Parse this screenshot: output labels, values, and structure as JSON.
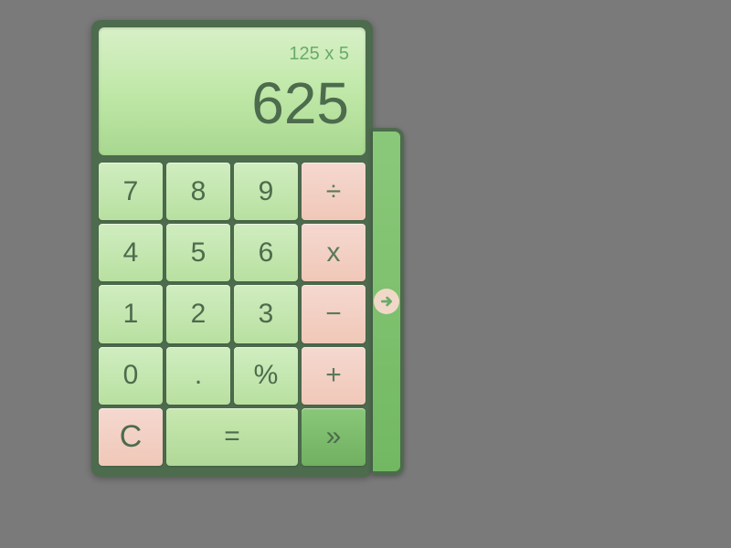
{
  "display": {
    "expression": "125 x 5",
    "result": "625"
  },
  "keys": {
    "n7": "7",
    "n8": "8",
    "n9": "9",
    "divide": "÷",
    "n4": "4",
    "n5": "5",
    "n6": "6",
    "multiply": "x",
    "n1": "1",
    "n2": "2",
    "n3": "3",
    "minus": "−",
    "n0": "0",
    "dot": ".",
    "percent": "%",
    "plus": "+",
    "clear": "C",
    "equals": "=",
    "more": "»"
  },
  "colors": {
    "frame": "#4d6b4d",
    "numKey": "#b8e0a0",
    "opKey": "#f0c8b8",
    "accent": "#72b862"
  }
}
